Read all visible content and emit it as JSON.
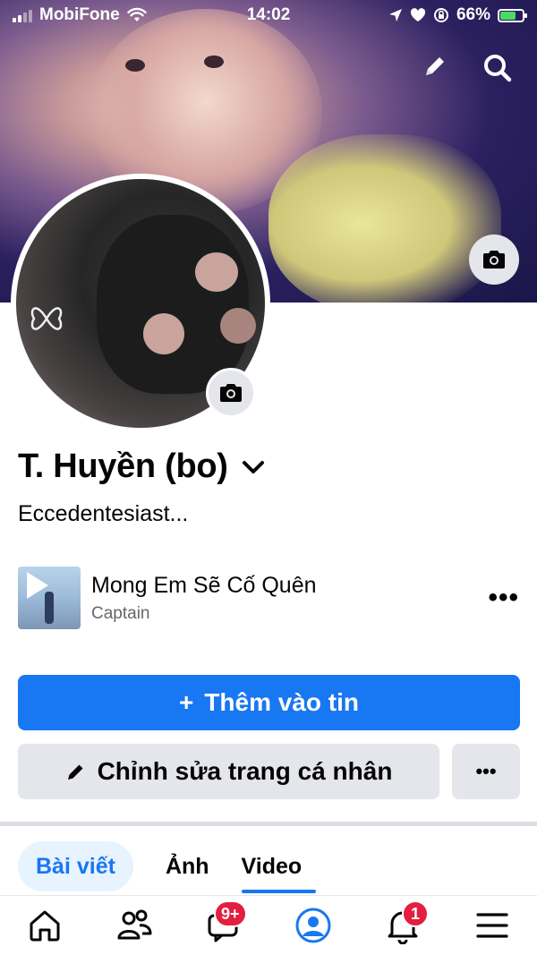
{
  "status_bar": {
    "carrier": "MobiFone",
    "time": "14:02",
    "battery_percent": "66%",
    "battery_level": 0.66
  },
  "header": {
    "edit_icon": "pencil-icon",
    "search_icon": "search-icon"
  },
  "profile": {
    "name": "T. Huyền (bo)",
    "bio": "Eccedentesiast..."
  },
  "music": {
    "song_title": "Mong Em Sẽ Cố Quên",
    "artist": "Captain",
    "more": "•••"
  },
  "actions": {
    "add_story_plus": "+",
    "add_story_label": "Thêm vào tin",
    "edit_profile_label": "Chỉnh sửa trang cá nhân",
    "more_label": "•••"
  },
  "tabs": [
    {
      "label": "Bài viết",
      "active": true
    },
    {
      "label": "Ảnh",
      "active": false
    },
    {
      "label": "Video",
      "active": false
    }
  ],
  "bottom_nav": {
    "messages_badge": "9+",
    "notifications_badge": "1"
  },
  "colors": {
    "accent": "#1877f2",
    "badge": "#e41e3f",
    "secondary_button": "#e4e6eb"
  }
}
